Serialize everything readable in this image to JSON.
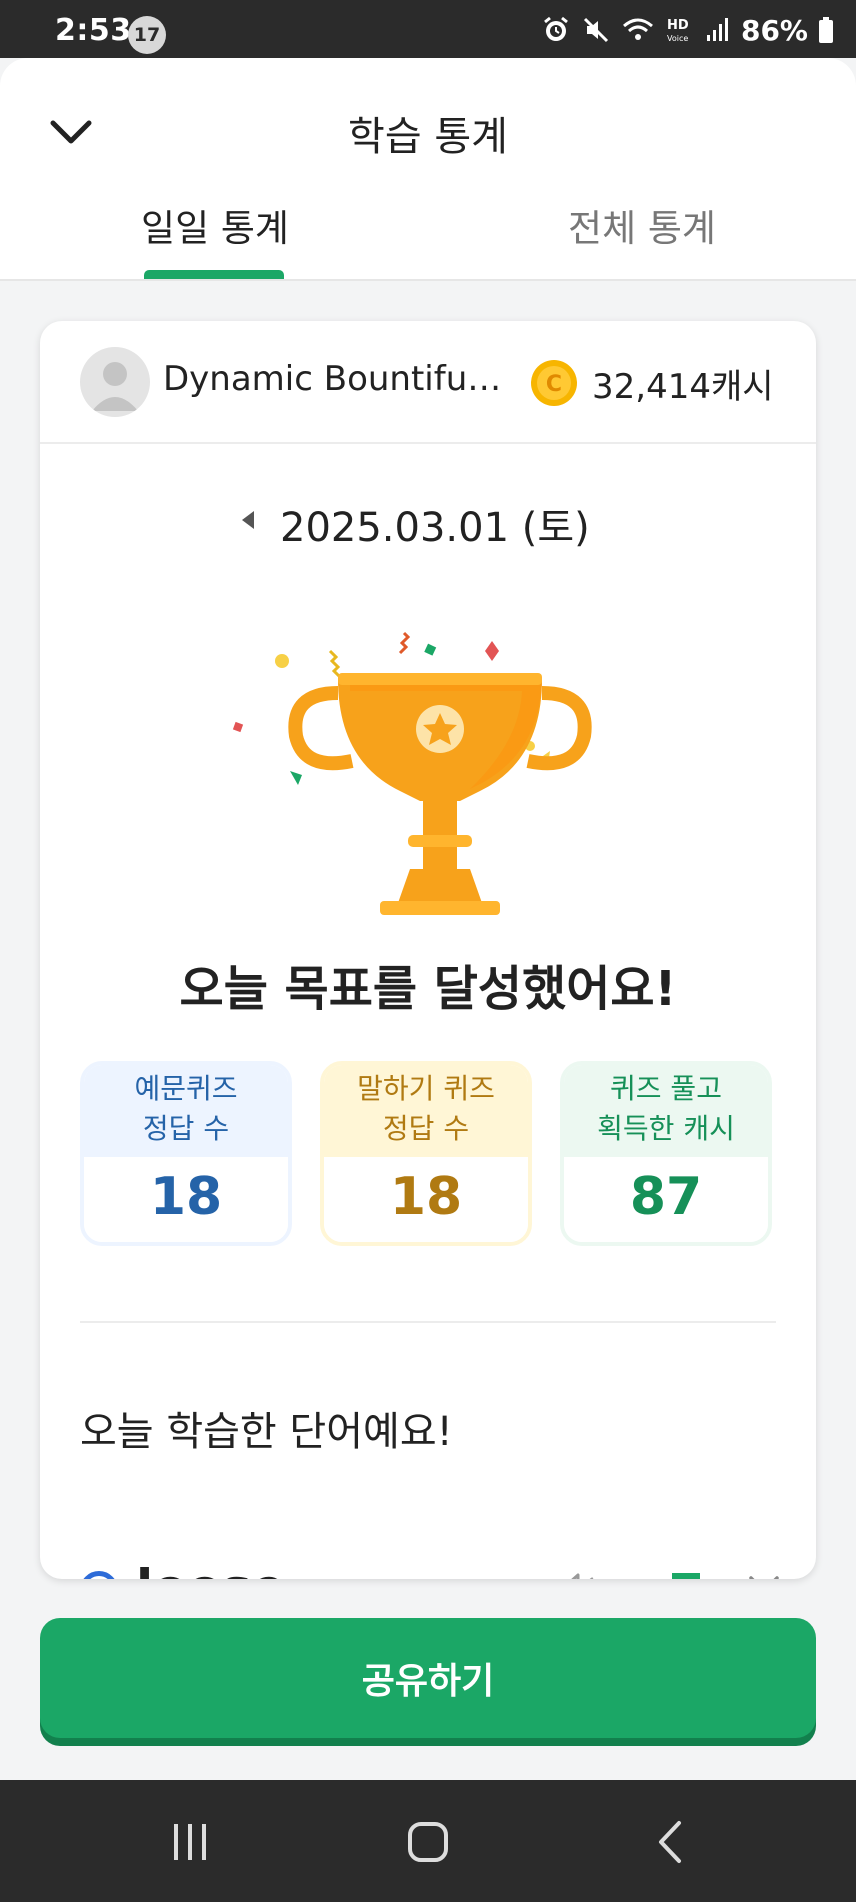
{
  "status_bar": {
    "time": "2:53",
    "notification_count": "17",
    "battery": "86%"
  },
  "header": {
    "title": "학습 통계",
    "tabs": [
      {
        "label": "일일 통계",
        "active": true
      },
      {
        "label": "전체 통계",
        "active": false
      }
    ]
  },
  "profile": {
    "name": "Dynamic Bountiful ...",
    "cash": "32,414캐시"
  },
  "date": {
    "label": "2025.03.01 (토)"
  },
  "achievement": {
    "message": "오늘 목표를 달성했어요!"
  },
  "stats": [
    {
      "label_line1": "예문퀴즈",
      "label_line2": "정답 수",
      "value": "18"
    },
    {
      "label_line1": "말하기 퀴즈",
      "label_line2": "정답 수",
      "value": "18"
    },
    {
      "label_line1": "퀴즈 풀고",
      "label_line2": "획득한 캐시",
      "value": "87"
    }
  ],
  "words": {
    "title": "오늘 학습한 단어예요!",
    "items": [
      {
        "word": "loose"
      }
    ]
  },
  "share_button": {
    "label": "공유하기"
  },
  "colors": {
    "brand_green": "#1ba766",
    "blue": "#2563a8",
    "gold": "#b07a12",
    "green_text": "#169058",
    "trophy": "#f7a21b"
  }
}
